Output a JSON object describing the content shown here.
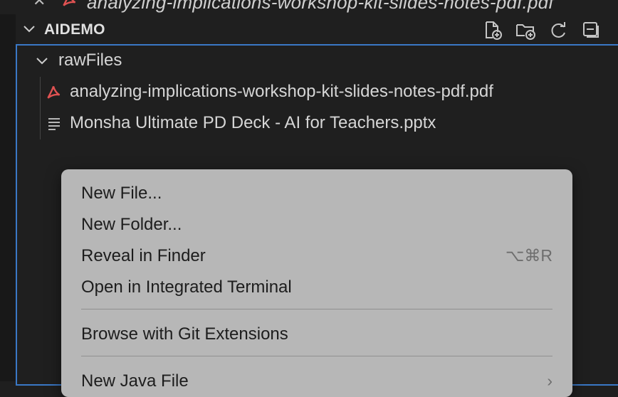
{
  "tab_strip": {
    "title": "analyzing-implications-workshop-kit-slides-notes-pdf.pdf"
  },
  "explorer": {
    "section_title": "AIDEMO",
    "actions": [
      {
        "name": "new-file-icon"
      },
      {
        "name": "new-folder-icon"
      },
      {
        "name": "refresh-icon"
      },
      {
        "name": "collapse-all-icon"
      }
    ],
    "folder": {
      "label": "rawFiles",
      "files": [
        {
          "label": "analyzing-implications-workshop-kit-slides-notes-pdf.pdf",
          "icon": "pdf-icon"
        },
        {
          "label": "Monsha Ultimate PD Deck - AI for Teachers.pptx",
          "icon": "text-file-icon"
        }
      ]
    }
  },
  "context_menu": {
    "items": [
      {
        "label": "New File...",
        "shortcut": ""
      },
      {
        "label": "New Folder...",
        "shortcut": ""
      },
      {
        "label": "Reveal in Finder",
        "shortcut": "⌥⌘R"
      },
      {
        "label": "Open in Integrated Terminal",
        "shortcut": ""
      },
      {
        "label": "Browse with Git Extensions",
        "shortcut": ""
      },
      {
        "label": "New Java File",
        "shortcut": "›"
      }
    ]
  },
  "colors": {
    "accent_border": "#3a78c6",
    "pdf_red": "#e05252",
    "menu_bg": "#b7b7b7"
  }
}
